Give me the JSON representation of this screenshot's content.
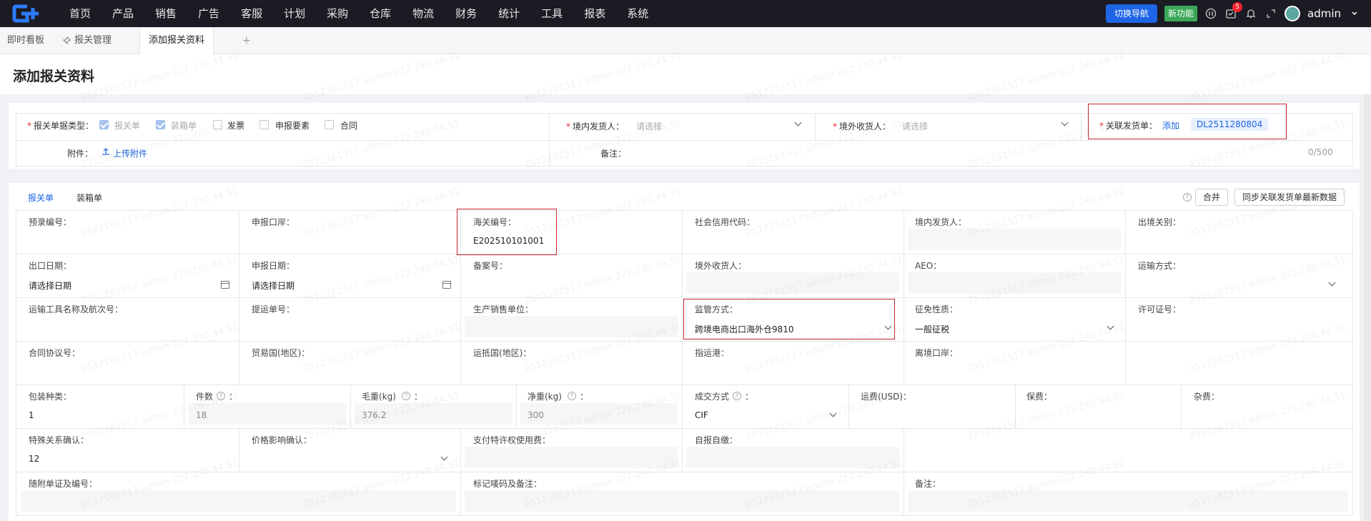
{
  "nav": {
    "menu": [
      "首页",
      "产品",
      "销售",
      "广告",
      "客服",
      "计划",
      "采购",
      "仓库",
      "物流",
      "财务",
      "统计",
      "工具",
      "报表",
      "系统"
    ],
    "switch_nav": "切换导航",
    "new_feature": "新功能",
    "notification_count": "5",
    "user": "admin"
  },
  "tabs": {
    "dashboard": "即时看板",
    "customs_mgmt": "报关管理",
    "add_customs": "添加报关资料",
    "add": "+"
  },
  "page_title": "添加报关资料",
  "top_form": {
    "doc_type_label": "报关单据类型：",
    "doc_types": [
      {
        "label": "报关单",
        "checked": true,
        "disabled": true
      },
      {
        "label": "装箱单",
        "checked": true,
        "disabled": true
      },
      {
        "label": "发票",
        "checked": false,
        "disabled": false
      },
      {
        "label": "申报要素",
        "checked": false,
        "disabled": false
      },
      {
        "label": "合同",
        "checked": false,
        "disabled": false
      }
    ],
    "domestic_shipper_label": "境内发货人：",
    "domestic_shipper_placeholder": "请选择",
    "overseas_consignee_label": "境外收货人：",
    "overseas_consignee_placeholder": "请选择",
    "linked_invoice_label": "关联发货单：",
    "linked_invoice_add": "添加",
    "linked_invoice_tag": "DL2511280804",
    "attachment_label": "附件：",
    "upload_label": "上传附件",
    "remark_label": "备注：",
    "remark_counter": "0/500"
  },
  "sub_tabs": [
    "报关单",
    "装箱单"
  ],
  "buttons": {
    "merge": "合并",
    "sync": "同步关联发货单最新数据"
  },
  "fields": {
    "preentry_no": {
      "label": "预录编号："
    },
    "declare_port": {
      "label": "申报口岸："
    },
    "customs_no": {
      "label": "海关编号：",
      "value": "E202510101001"
    },
    "credit_code": {
      "label": "社会信用代码："
    },
    "domestic_shipper": {
      "label": "境内发货人："
    },
    "exit_customs": {
      "label": "出境关别："
    },
    "export_date": {
      "label": "出口日期：",
      "placeholder": "请选择日期"
    },
    "declare_date": {
      "label": "申报日期：",
      "placeholder": "请选择日期"
    },
    "record_no": {
      "label": "备案号："
    },
    "overseas_consignee": {
      "label": "境外收货人："
    },
    "aeo": {
      "label": "AEO："
    },
    "transport_mode": {
      "label": "运输方式："
    },
    "transport_name": {
      "label": "运输工具名称及航次号："
    },
    "bill_no": {
      "label": "提运单号："
    },
    "producer": {
      "label": "生产销售单位："
    },
    "supervision": {
      "label": "监管方式：",
      "value": "跨境电商出口海外仓9810"
    },
    "levy_nature": {
      "label": "征免性质：",
      "value": "一般征税"
    },
    "license_no": {
      "label": "许可证号："
    },
    "contract_no": {
      "label": "合同协议号："
    },
    "trade_country": {
      "label": "贸易国(地区)："
    },
    "dest_country": {
      "label": "运抵国(地区)："
    },
    "port_of_loading": {
      "label": "指运港："
    },
    "exit_port": {
      "label": "离境口岸："
    },
    "package_type": {
      "label": "包装种类：",
      "value": "1"
    },
    "pieces": {
      "label": "件数",
      "value": "18"
    },
    "gross_weight": {
      "label": "毛重(kg)",
      "value": "376.2"
    },
    "net_weight": {
      "label": "净重(kg)",
      "value": "300"
    },
    "deal_mode": {
      "label": "成交方式",
      "value": "CIF"
    },
    "freight": {
      "label": "运费(USD)："
    },
    "insurance": {
      "label": "保费："
    },
    "misc_fee": {
      "label": "杂费："
    },
    "special_relation": {
      "label": "特殊关系确认：",
      "value": "12"
    },
    "price_impact": {
      "label": "价格影响确认："
    },
    "royalty": {
      "label": "支付特许权使用费："
    },
    "self_report": {
      "label": "自报自缴："
    },
    "attached_docs": {
      "label": "随附单证及编号："
    },
    "marks": {
      "label": "标记唛码及备注："
    },
    "remark": {
      "label": "备注："
    }
  },
  "watermark_text": "2512161517 admin 222.240.44.51",
  "colors": {
    "primary": "#1e64e6",
    "nav_bg": "#1b1b24",
    "required": "#f5222d",
    "highlight_box": "#c8232c"
  }
}
